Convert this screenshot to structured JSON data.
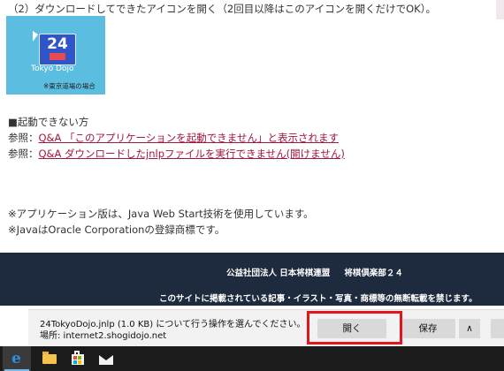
{
  "page": {
    "step_text": "（2）ダウンロードしてできたアイコンを開く（2回目以降はこのアイコンを開くだけでOK）。",
    "thumbnail": {
      "icon_number": "24",
      "app_name": "Tokyo Dojo",
      "note": "※東京道場の場合"
    },
    "help": {
      "heading": "■起動できない方",
      "refs": [
        {
          "prefix": "参照：",
          "link": "Q&A 「このアプリケーションを起動できません」と表示されます"
        },
        {
          "prefix": "参照：",
          "link": "Q&A ダウンロードしたjnlpファイルを実行できません(開けません)"
        }
      ]
    },
    "notes": [
      "※アプリケーション版は、Java Web Start技術を使用しています。",
      "※JavaはOracle Corporationの登録商標です。"
    ]
  },
  "footer": {
    "org": "公益社団法人 日本将棋連盟",
    "club": "将棋倶楽部２４",
    "copyright": "このサイトに掲載されている記事・イラスト・写真・商標等の無断転載を禁じます。"
  },
  "download_bar": {
    "message": "24TokyoDojo.jnlp (1.0 KB) について行う操作を選んでください。",
    "location": "場所: internet2.shogidojo.net",
    "open_label": "開く",
    "save_label": "保存",
    "chevron_up": "∧",
    "highlight_color": "#e0161c"
  },
  "taskbar": {
    "items": [
      "edge-icon",
      "file-explorer-icon",
      "store-icon",
      "mail-icon"
    ],
    "edge_glyph": "e"
  }
}
